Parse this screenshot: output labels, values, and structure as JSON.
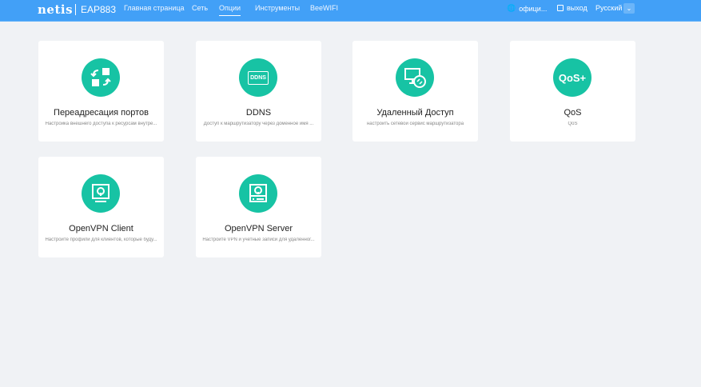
{
  "header": {
    "logo": "netis",
    "model": "EAP883",
    "nav": [
      "Главная страница",
      "Сеть",
      "Опции",
      "Инструменты",
      "BeeWIFI"
    ],
    "active_nav": "Опции",
    "official": "офици...",
    "logout": "выход",
    "language": "Русский"
  },
  "cards": [
    {
      "title": "Переадресация портов",
      "desc": "Настройка внешнего доступа к ресурсам внутре...",
      "icon": "port-forward-icon"
    },
    {
      "title": "DDNS",
      "desc": "Доступ к маршрутизатору через доменное имя ...",
      "icon": "ddns-icon",
      "icon_text": "DDNS"
    },
    {
      "title": "Удаленный Доступ",
      "desc": "настроить сетевой сервис маршрутизатора",
      "icon": "remote-access-icon"
    },
    {
      "title": "QoS",
      "desc": "QoS",
      "icon": "qos-icon",
      "icon_text": "QoS+"
    },
    {
      "title": "OpenVPN Client",
      "desc": "Настройте профили для клиентов, которые буду...",
      "icon": "openvpn-client-icon"
    },
    {
      "title": "OpenVPN Server",
      "desc": "Настройте VPN и учетные записи для удаленног...",
      "icon": "openvpn-server-icon"
    }
  ],
  "colors": {
    "header": "#42a0f7",
    "accent": "#17c3a4",
    "bg": "#f0f2f5"
  }
}
